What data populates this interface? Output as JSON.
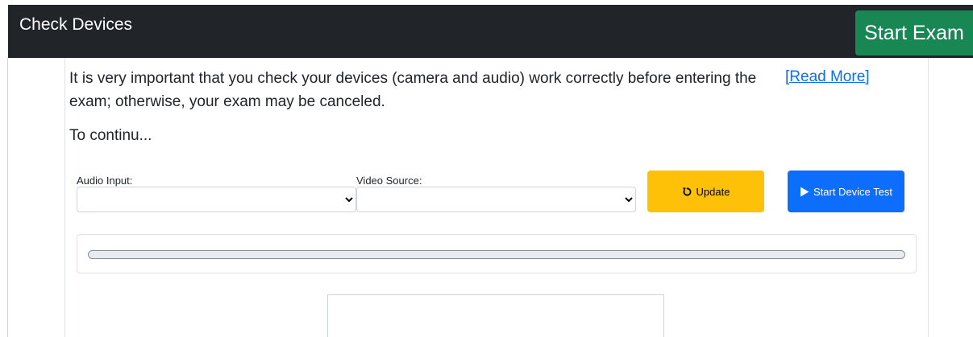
{
  "header": {
    "title": "Check Devices",
    "start_exam_label": "Start Exam"
  },
  "notice": {
    "text": "It is very important that you check your devices (camera and audio) work correctly before entering the exam; otherwise, your exam may be canceled.",
    "read_more": "[Read More]",
    "continue_text": "To continu..."
  },
  "form": {
    "audio_label": "Audio Input:",
    "audio_value": "",
    "video_label": "Video Source:",
    "video_value": "",
    "update_label": "Update",
    "update_icon": "undo-icon",
    "start_test_label": "Start Device Test",
    "start_test_icon": "play-icon"
  },
  "progress": {
    "value_fraction": 0
  },
  "colors": {
    "header_bg": "#212529",
    "start_exam": "#198754",
    "update_button": "#ffc107",
    "test_button": "#0d6efd",
    "link": "#0d6efd"
  }
}
